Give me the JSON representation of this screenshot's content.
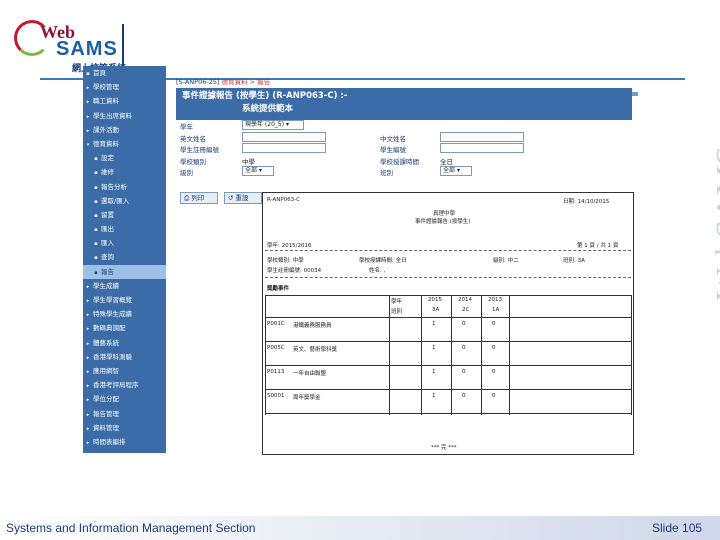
{
  "logo": {
    "web": "Web",
    "sams": "SAMS",
    "cn": "網上校管系統"
  },
  "sidebar": {
    "items": [
      {
        "label": "首頁",
        "mark": "▪",
        "sub": false
      },
      {
        "label": "學校管理",
        "mark": "▸",
        "sub": false
      },
      {
        "label": "職工資料",
        "mark": "▸",
        "sub": false
      },
      {
        "label": "學生出席資料",
        "mark": "▸",
        "sub": false
      },
      {
        "label": "課外活動",
        "mark": "▸",
        "sub": false
      },
      {
        "label": "德育資料",
        "mark": "▾",
        "sub": false
      },
      {
        "label": "設定",
        "mark": "▪",
        "sub": true
      },
      {
        "label": "維修",
        "mark": "▪",
        "sub": true
      },
      {
        "label": "報告分析",
        "mark": "▪",
        "sub": true
      },
      {
        "label": "選取/匯入",
        "mark": "▪",
        "sub": true
      },
      {
        "label": "留置",
        "mark": "▪",
        "sub": true
      },
      {
        "label": "匯出",
        "mark": "▪",
        "sub": true
      },
      {
        "label": "匯入",
        "mark": "▪",
        "sub": true
      },
      {
        "label": "查詢",
        "mark": "▪",
        "sub": true
      },
      {
        "label": "報告",
        "mark": "▪",
        "sub": true,
        "active": true
      },
      {
        "label": "學生成績",
        "mark": "▸",
        "sub": false
      },
      {
        "label": "學生學習概覽",
        "mark": "▸",
        "sub": false
      },
      {
        "label": "特殊學生成績",
        "mark": "▸",
        "sub": false
      },
      {
        "label": "數碼典調配",
        "mark": "▸",
        "sub": false
      },
      {
        "label": "體藝系統",
        "mark": "▸",
        "sub": false
      },
      {
        "label": "香港學科測驗",
        "mark": "▸",
        "sub": false
      },
      {
        "label": "應用網智",
        "mark": "▸",
        "sub": false
      },
      {
        "label": "香港考評局程序",
        "mark": "▸",
        "sub": false
      },
      {
        "label": "學位分配",
        "mark": "▸",
        "sub": false
      },
      {
        "label": "報告管理",
        "mark": "▸",
        "sub": false
      },
      {
        "label": "資料管理",
        "mark": "▸",
        "sub": false
      },
      {
        "label": "時間表編排",
        "mark": "▸",
        "sub": false
      }
    ]
  },
  "breadcrumb": {
    "code": "[S-ANP06-25]",
    "path": "德育資料 > 報告"
  },
  "panel": {
    "title": "事件證據報告 (按學生) (R-ANP063-C) :-",
    "subtitle": "系統提供範本"
  },
  "form": {
    "school_year_label": "學年",
    "school_year_value": "現學年 (20_5)",
    "eng_name_label": "英文姓名",
    "chi_name_label": "中文姓名",
    "reg_no_label": "學生註冊編號",
    "student_no_label": "學生編號",
    "school_level_label": "學校類別",
    "school_level_value": "中學",
    "session_label": "學校授課時間",
    "session_value": "全日",
    "class_level_label": "級別",
    "class_level_value": "全部",
    "class_label": "班別",
    "class_value": "全部"
  },
  "buttons": {
    "print": "列印",
    "reset": "重設"
  },
  "report": {
    "code": "R-ANP063-C",
    "date": "日期: 14/10/2015",
    "school": "真理中學",
    "title": "事件證據報告 (按學生)",
    "year": "學年: 2015/2016",
    "page": "第 1 頁 / 共 1 頁",
    "row1a": "學校類別: 中學",
    "row1b": "學校授課時間: 全日",
    "row1c": "級別: 中二",
    "row1d": "班別: 3A",
    "row2a": "學生註冊編號: 00034",
    "row2b": "姓名: 、",
    "section": "獎勵事件",
    "col_year": "學年",
    "col_class": "班別",
    "years": [
      "2015",
      "2014",
      "2013"
    ],
    "classes": [
      "3A",
      "2C",
      "1A"
    ],
    "rows": [
      {
        "code": "P001C",
        "desc": "港鐵義務服務員",
        "vals": [
          "1",
          "0",
          "0"
        ]
      },
      {
        "code": "P005C",
        "desc": "英文、藝術學科獎",
        "vals": [
          "1",
          "0",
          "0"
        ]
      },
      {
        "code": "P0113",
        "desc": "一年自由聯盟",
        "vals": [
          "1",
          "0",
          "0"
        ]
      },
      {
        "code": "S0001",
        "desc": "周年獎學金",
        "vals": [
          "1",
          "0",
          "0"
        ]
      }
    ],
    "end": "*** 完 ***"
  },
  "watermark": "WebSAMS",
  "footer": {
    "left": "Systems and Information Management Section",
    "right": "Slide 105"
  }
}
